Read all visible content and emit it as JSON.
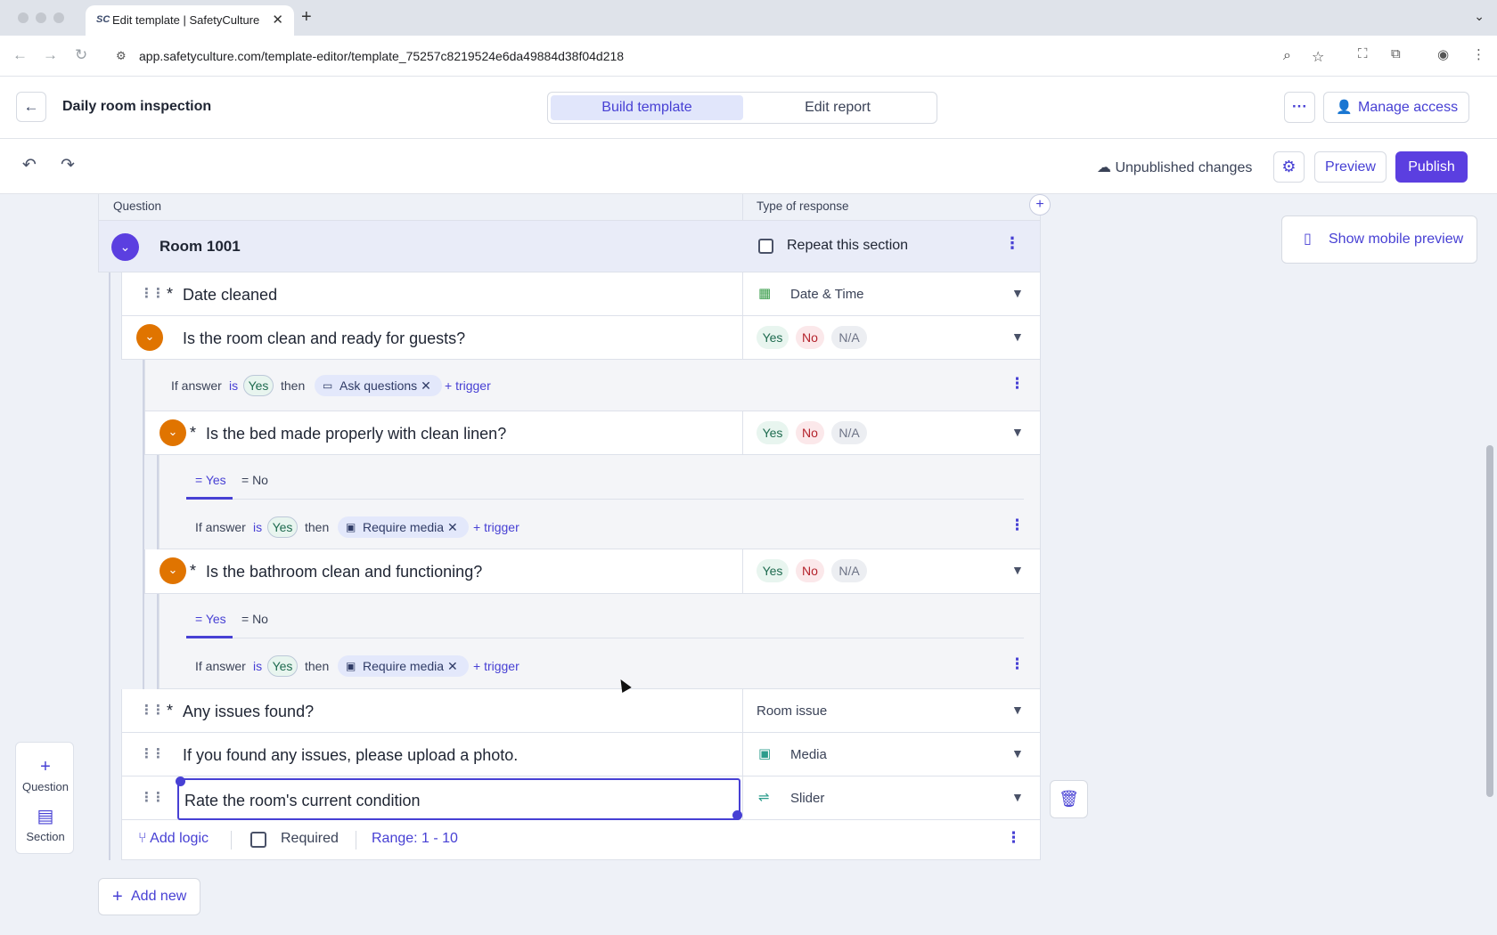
{
  "browser": {
    "tab_title": "Edit template | SafetyCulture",
    "favicon": "SC",
    "url": "app.safetyculture.com/template-editor/template_75257c8219524e6da49884d38f04d218"
  },
  "header": {
    "template_title": "Daily room inspection",
    "tabs": [
      "Build template",
      "Edit report"
    ],
    "manage_access": "Manage access"
  },
  "subheader": {
    "status": "Unpublished changes",
    "preview": "Preview",
    "publish": "Publish"
  },
  "columns": {
    "question": "Question",
    "type": "Type of response"
  },
  "section": {
    "title": "Room 1001",
    "repeat_label": "Repeat this section"
  },
  "questions": [
    {
      "text": "Date cleaned",
      "required": "*",
      "type": "Date & Time",
      "icon": "calendar-icon"
    },
    {
      "text": "Is the room clean and ready for guests?",
      "type_options": [
        "Yes",
        "No",
        "N/A"
      ]
    },
    {
      "text": "Is the bed made properly with clean linen?",
      "required": "*",
      "type_options": [
        "Yes",
        "No",
        "N/A"
      ]
    },
    {
      "text": "Is the bathroom clean and functioning?",
      "required": "*",
      "type_options": [
        "Yes",
        "No",
        "N/A"
      ]
    },
    {
      "text": "Any issues found?",
      "required": "*",
      "type": "Room issue"
    },
    {
      "text": "If you found any issues, please upload a photo.",
      "type": "Media",
      "icon": "image-icon"
    },
    {
      "text": "Rate the room's current condition",
      "type": "Slider",
      "icon": "slider-icon"
    }
  ],
  "logic": {
    "if_answer": "If answer",
    "is": "is",
    "then": "then",
    "yes": "Yes",
    "trigger": "+ trigger",
    "ask_questions": "Ask questions",
    "require_media": "Require media",
    "tab_yes": "= Yes",
    "tab_no": "= No"
  },
  "footer": {
    "add_logic": "Add logic",
    "required": "Required",
    "range": "Range: 1 - 10"
  },
  "add_new": "Add new",
  "palette": {
    "question": "Question",
    "section": "Section"
  },
  "mobile_preview": "Show mobile preview",
  "colors": {
    "accent": "#4740d4",
    "publish": "#5b3fe0",
    "orange_toggle": "#e07400"
  }
}
